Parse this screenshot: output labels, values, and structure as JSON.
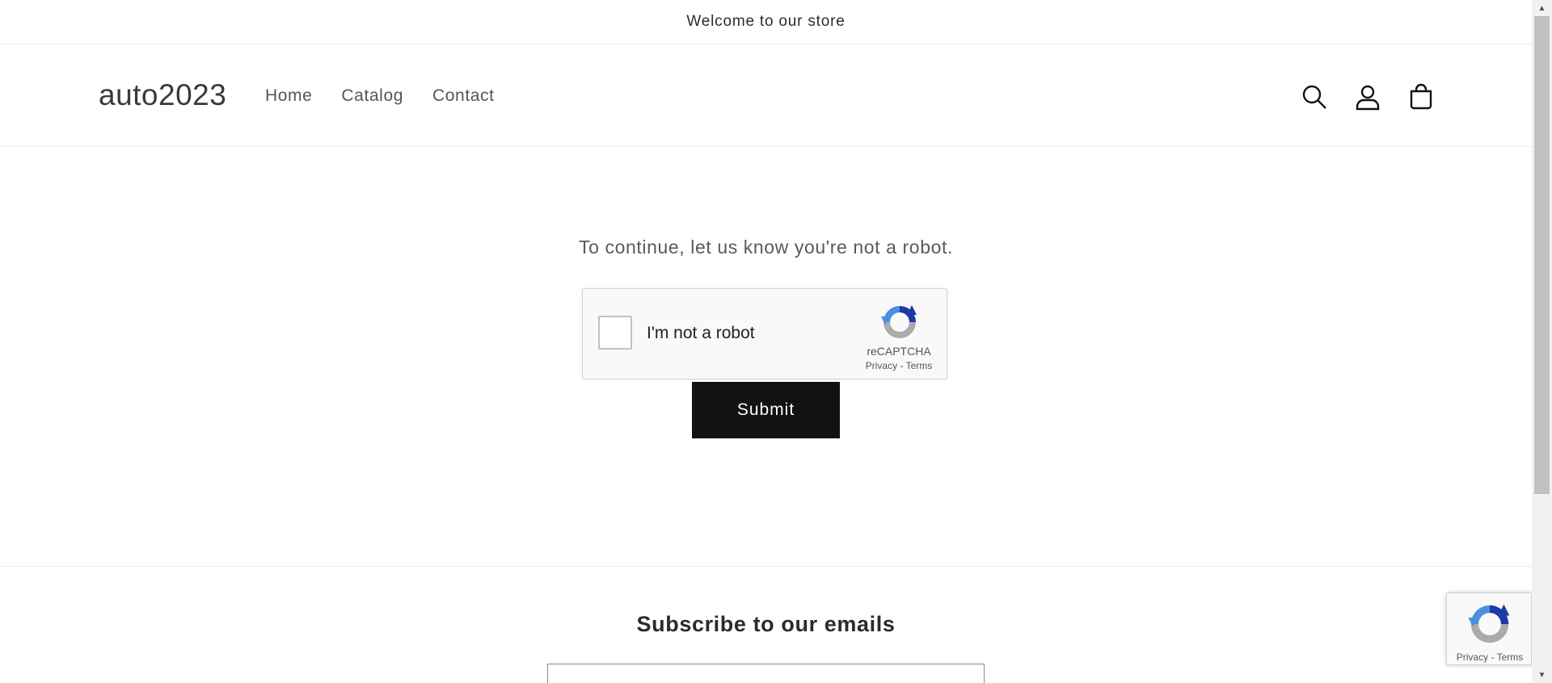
{
  "announcement": {
    "text": "Welcome to our store"
  },
  "header": {
    "logo": "auto2023",
    "nav": [
      {
        "label": "Home"
      },
      {
        "label": "Catalog"
      },
      {
        "label": "Contact"
      }
    ],
    "icons": [
      "search-icon",
      "account-icon",
      "cart-icon"
    ]
  },
  "main": {
    "prompt": "To continue, let us know you're not a robot.",
    "recaptcha": {
      "label": "I'm not a robot",
      "brand": "reCAPTCHA",
      "privacy": "Privacy",
      "separator": " - ",
      "terms": "Terms",
      "checked": false
    },
    "submit_label": "Submit"
  },
  "footer": {
    "subscribe_title": "Subscribe to our emails"
  },
  "badge": {
    "privacy": "Privacy",
    "separator": " - ",
    "terms": "Terms"
  },
  "colors": {
    "button_bg": "#121212",
    "recaptcha_blue": "#4a90e2",
    "recaptcha_dark_blue": "#1c3aa9",
    "recaptcha_gray": "#ababab"
  }
}
